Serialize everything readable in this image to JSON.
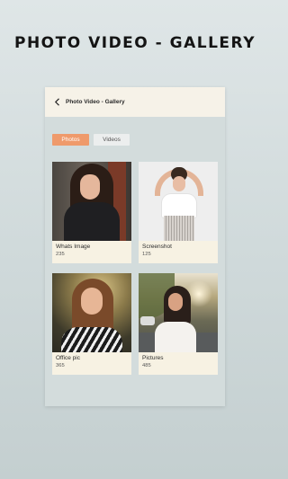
{
  "headline": "PHOTO VIDEO - GALLERY",
  "appbar": {
    "title": "Photo Video - Gallery",
    "back_icon": "chevron-left-icon"
  },
  "tabs": [
    {
      "label": "Photos",
      "active": true,
      "color": "#ef9a6b"
    },
    {
      "label": "Videos",
      "active": false
    }
  ],
  "albums": [
    {
      "title": "Whats Image",
      "count": "235"
    },
    {
      "title": "Screenshot",
      "count": "125"
    },
    {
      "title": "Office pic",
      "count": "365"
    },
    {
      "title": "Pictures",
      "count": "485"
    }
  ],
  "colors": {
    "card_bg": "#f7f2e3",
    "appbar_bg": "#f6f2e8",
    "accent": "#ef9a6b"
  }
}
